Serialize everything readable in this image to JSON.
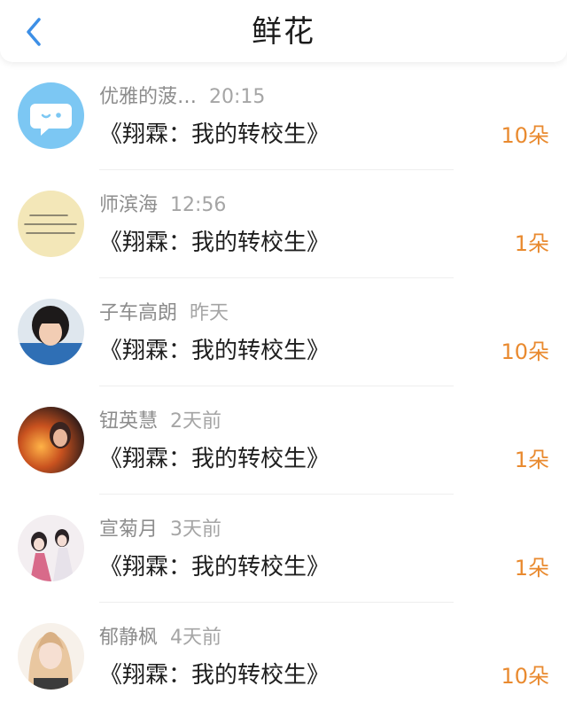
{
  "header": {
    "title": "鲜花",
    "back_icon": "chevron-left-icon",
    "accent": "#3d8fe6"
  },
  "colors": {
    "count": "#e98a2f",
    "name": "#8d8d8d",
    "book": "#1f1f1f"
  },
  "items": [
    {
      "name": "优雅的菠…",
      "time": "20:15",
      "book": "《翔霖：我的转校生》",
      "count": "10朵",
      "avatar": "chat-bubble-avatar"
    },
    {
      "name": "师滨海",
      "time": "12:56",
      "book": "《翔霖：我的转校生》",
      "count": "1朵",
      "avatar": "text-note-avatar"
    },
    {
      "name": "子车高朗",
      "time": "昨天",
      "book": "《翔霖：我的转校生》",
      "count": "10朵",
      "avatar": "girl-photo-avatar"
    },
    {
      "name": "钮英慧",
      "time": "2天前",
      "book": "《翔霖：我的转校生》",
      "count": "1朵",
      "avatar": "fire-portrait-avatar"
    },
    {
      "name": "宣菊月",
      "time": "3天前",
      "book": "《翔霖：我的转校生》",
      "count": "1朵",
      "avatar": "ancient-costume-avatar"
    },
    {
      "name": "郁静枫",
      "time": "4天前",
      "book": "《翔霖：我的转校生》",
      "count": "10朵",
      "avatar": "anime-girl-avatar"
    }
  ]
}
